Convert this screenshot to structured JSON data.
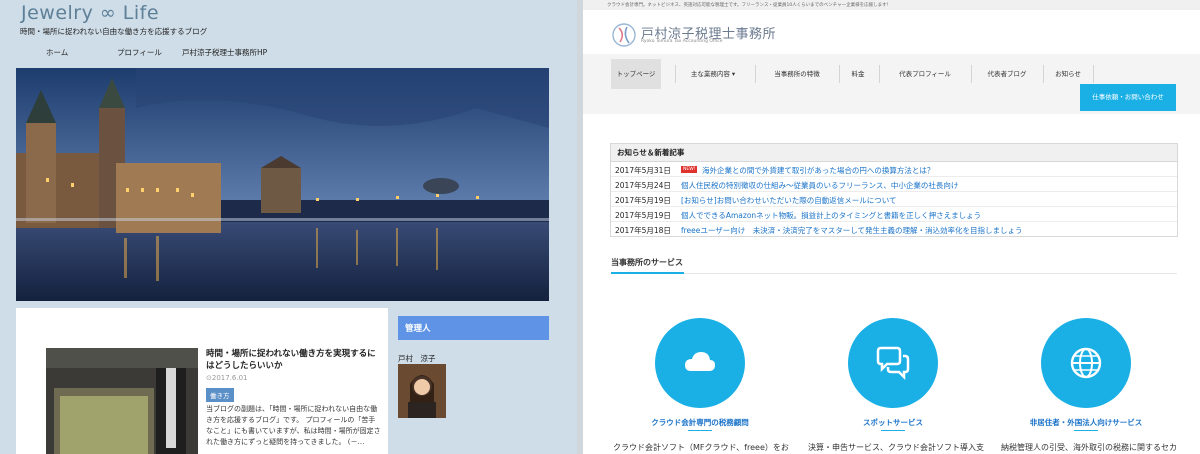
{
  "blog": {
    "logo": "Jewelry ∞ Life",
    "tagline": "時間・場所に捉われない自由な働き方を応援するブログ",
    "nav": [
      "ホーム",
      "プロフィール",
      "戸村涼子税理士事務所HP"
    ],
    "post": {
      "title": "時間・場所に捉われない働き方を実現するにはどうしたらいいか",
      "date": "2017.6.01",
      "category": "働き方",
      "excerpt": "当ブログの副題は、「時間・場所に捉われない自由な働き方を応援するブログ」です。 プロフィールの「苦手なこと」にも書いていますが、私は時間・場所が固定された働き方にずっと疑問を持ってきました。 (－…"
    },
    "sidebar": {
      "heading": "管理人",
      "name": "戸村　涼子"
    }
  },
  "site": {
    "top_strip": "クラウド会計専門。ネットビジネス、英語対応可能な税理士です。フリーランス・従業員10人くらいまでのベンチャー企業様を応援します！",
    "brand_title": "戸村涼子税理士事務所",
    "brand_sub": "Ryoko Tomura Tax Accounting Office",
    "nav": [
      "トップページ",
      "主な業務内容 ▾",
      "当事務所の特徴",
      "料金",
      "代表プロフィール",
      "代表者ブログ",
      "お知らせ"
    ],
    "contact_button": "仕事依頼・お問い合わせ",
    "news": {
      "heading": "お知らせ＆新着記事",
      "new_badge": "NEW!",
      "items": [
        {
          "date": "2017年5月31日",
          "title": "海外企業との間で外貨建て取引があった場合の円への換算方法とは？",
          "is_new": true
        },
        {
          "date": "2017年5月24日",
          "title": "個人住民税の特別徴収の仕組み～従業員のいるフリーランス、中小企業の社長向け"
        },
        {
          "date": "2017年5月19日",
          "title": "[お知らせ]お問い合わせいただいた際の自動返信メールについて"
        },
        {
          "date": "2017年5月19日",
          "title": "個人でできるAmazonネット物販。損益計上のタイミングと書籍を正しく押さえましょう"
        },
        {
          "date": "2017年5月18日",
          "title": "freeeユーザー向け　未決済・決済完了をマスターして発生主義の理解・消込効率化を目指しましょう"
        }
      ]
    },
    "services": {
      "heading": "当事務所のサービス",
      "items": [
        {
          "icon": "cloud-icon",
          "name": "クラウド会計専門の税務顧問",
          "desc": "クラウド会計ソフト（MFクラウド、freee）をお"
        },
        {
          "icon": "chat-bubbles-icon",
          "name": "スポットサービス",
          "desc": "決算・申告サービス、クラウド会計ソフト導入支"
        },
        {
          "icon": "globe-icon",
          "name": "非居住者・外国法人向けサービス",
          "desc": "納税管理人の引受、海外取引の税務に関するセカ"
        }
      ]
    },
    "accent": "#1ab0e6"
  }
}
